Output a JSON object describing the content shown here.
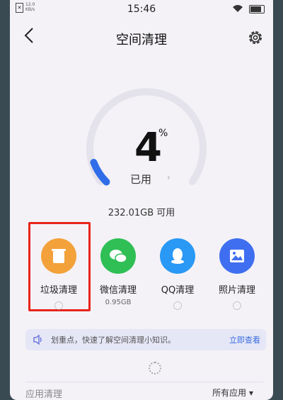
{
  "status_bar": {
    "speed": "12.0\nKB/s",
    "time": "15:46"
  },
  "header": {
    "title": "空间清理"
  },
  "storage": {
    "used_percent": "4",
    "percent_sign": "%",
    "used_label": "已用",
    "available_text": "232.01GB 可用",
    "gauge_fill_percent": 4
  },
  "categories": [
    {
      "label": "垃圾清理",
      "sub": "",
      "color": "#f3a13a",
      "icon": "trash-icon"
    },
    {
      "label": "微信清理",
      "sub": "0.95GB",
      "color": "#2fbf55",
      "icon": "wechat-icon"
    },
    {
      "label": "QQ清理",
      "sub": "",
      "color": "#2a98f5",
      "icon": "qq-icon"
    },
    {
      "label": "照片清理",
      "sub": "",
      "color": "#3f6ff0",
      "icon": "photo-icon"
    }
  ],
  "tip": {
    "text": "划重点，快速了解空间清理小知识。",
    "action": "立即查看"
  },
  "section": {
    "title": "应用清理",
    "filter": "所有应用"
  },
  "colors": {
    "highlight": "#e8241c",
    "accent_blue": "#3a6fe0"
  }
}
